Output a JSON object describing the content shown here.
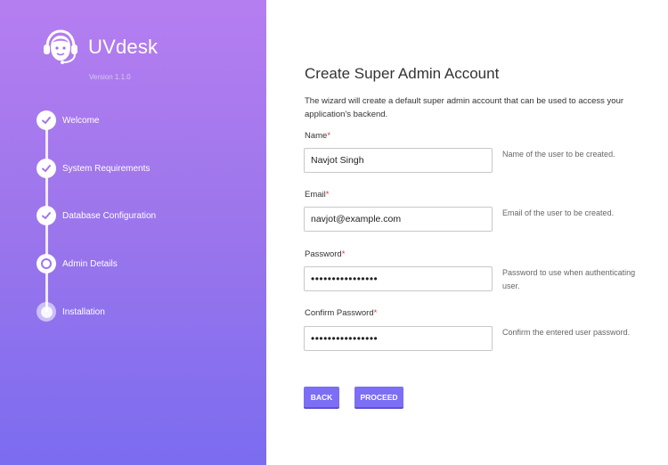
{
  "sidebar": {
    "brand_name": "UVdesk",
    "version": "Version 1.1.0",
    "steps": [
      {
        "label": "Welcome",
        "status": "completed"
      },
      {
        "label": "System Requirements",
        "status": "completed"
      },
      {
        "label": "Database Configuration",
        "status": "completed"
      },
      {
        "label": "Admin Details",
        "status": "current"
      },
      {
        "label": "Installation",
        "status": "pending"
      }
    ]
  },
  "main": {
    "title": "Create Super Admin Account",
    "description": "The wizard will create a default super admin account that can be used to access your application's backend.",
    "fields": {
      "name": {
        "label": "Name",
        "required_mark": "*",
        "value": "Navjot Singh",
        "hint": "Name of the user to be created."
      },
      "email": {
        "label": "Email",
        "required_mark": "*",
        "value": "navjot@example.com",
        "hint": "Email of the user to be created."
      },
      "password": {
        "label": "Password",
        "required_mark": "*",
        "value": "••••••••••••••••",
        "hint": "Password to use when authenticating user."
      },
      "confirm_password": {
        "label": "Confirm Password",
        "required_mark": "*",
        "value": "••••••••••••••••",
        "hint": "Confirm the entered user password."
      }
    },
    "buttons": {
      "back": "BACK",
      "proceed": "PROCEED"
    }
  },
  "colors": {
    "sidebar_top": "#b57ef0",
    "sidebar_bottom": "#7b6cf0",
    "button": "#7c6ef5",
    "required": "#e0333a"
  }
}
